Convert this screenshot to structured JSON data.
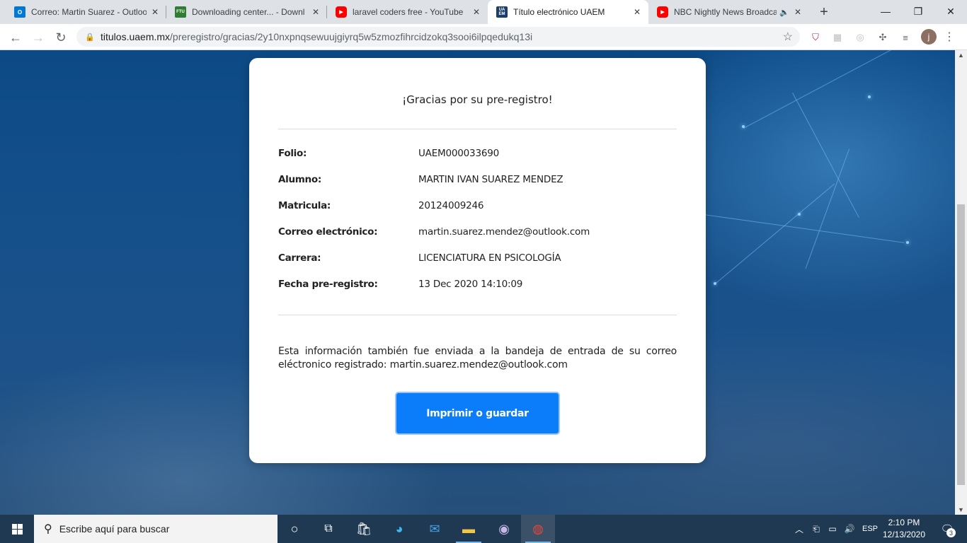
{
  "browser": {
    "tabs": [
      {
        "title": "Correo: Martin Suarez - Outlook",
        "favicon": "outlook-icon",
        "favicon_color": "#0078d4",
        "favicon_text": "O",
        "active": false
      },
      {
        "title": "Downloading center... - Downl",
        "favicon": "ftu-icon",
        "favicon_color": "#2e7d32",
        "favicon_text": "FTU",
        "active": false
      },
      {
        "title": "laravel coders free - YouTube",
        "favicon": "youtube-icon",
        "favicon_color": "#ff0000",
        "favicon_text": "▶",
        "active": false
      },
      {
        "title": "Título electrónico UAEM",
        "favicon": "uaem-icon",
        "favicon_color": "#1a3d6e",
        "favicon_text": "UA EM",
        "active": true
      },
      {
        "title": "NBC Nightly News Broadca",
        "favicon": "youtube-icon",
        "favicon_color": "#ff0000",
        "favicon_text": "▶",
        "active": false,
        "audio": true
      }
    ],
    "new_tab": "+",
    "window_controls": {
      "minimize": "—",
      "maximize": "❐",
      "close": "✕"
    },
    "address": {
      "host": "titulos.uaem.mx",
      "path": "/preregistro/gracias/2y10nxpnqsewuujgiyrq5w5zmozfihrcidzokq3sooi6ilpqedukq13i"
    },
    "profile_initial": "j"
  },
  "card": {
    "title": "¡Gracias por su pre-registro!",
    "fields": [
      {
        "label": "Folio:",
        "value": "UAEM000033690"
      },
      {
        "label": "Alumno:",
        "value": "MARTIN IVAN SUAREZ MENDEZ"
      },
      {
        "label": "Matricula:",
        "value": "20124009246"
      },
      {
        "label": "Correo electrónico:",
        "value": "martin.suarez.mendez@outlook.com"
      },
      {
        "label": "Carrera:",
        "value": "LICENCIATURA EN PSICOLOGÍA"
      },
      {
        "label": "Fecha pre-registro:",
        "value": "13 Dec 2020 14:10:09"
      }
    ],
    "notice": "Esta información también fue enviada a la bandeja de entrada de su correo eléctronico registrado: martin.suarez.mendez@outlook.com",
    "print_button": "Imprimir o guardar"
  },
  "taskbar": {
    "search_placeholder": "Escribe aquí para buscar",
    "language": "ESP",
    "time": "2:10 PM",
    "date": "12/13/2020",
    "notification_count": "3"
  },
  "colors": {
    "button": "#0b7dfb",
    "taskbar": "#1f3953",
    "tabstrip": "#dee1e6"
  }
}
